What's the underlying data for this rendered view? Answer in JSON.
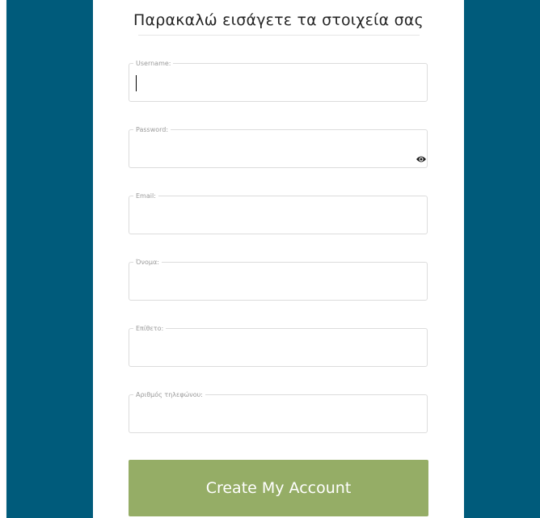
{
  "colors": {
    "side_bg": "#005b7b",
    "button_bg": "#95ad66"
  },
  "form": {
    "title": "Παρακαλώ εισάγετε τα στοιχεία σας",
    "fields": [
      {
        "label": "Username:",
        "value": "",
        "placeholder": ""
      },
      {
        "label": "Password:",
        "value": "",
        "placeholder": ""
      },
      {
        "label": "Email:",
        "value": "",
        "placeholder": ""
      },
      {
        "label": "Όνομα:",
        "value": "",
        "placeholder": ""
      },
      {
        "label": "Επίθετο:",
        "value": "",
        "placeholder": ""
      },
      {
        "label": "Αριθμός τηλεφώνου:",
        "value": "",
        "placeholder": ""
      }
    ],
    "password_toggle_icon": "eye-icon",
    "submit_label": "Create My Account"
  }
}
